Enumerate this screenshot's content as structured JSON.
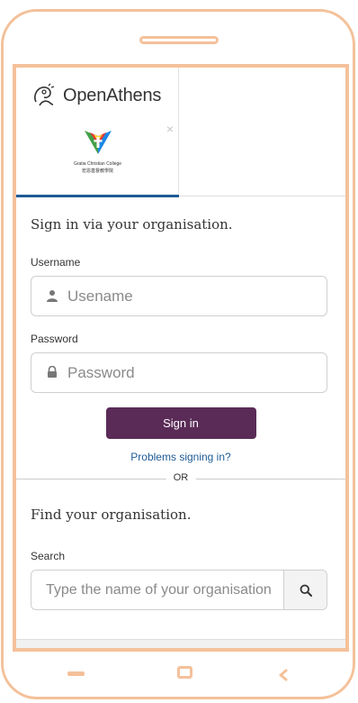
{
  "brand": {
    "name": "OpenAthens"
  },
  "org_tab": {
    "caption": "Gratia Christian College",
    "caption_cn": "宏恩基督教學院",
    "close_glyph": "×"
  },
  "signin": {
    "title": "Sign in via your organisation.",
    "username_label": "Username",
    "username_placeholder": "Usename",
    "password_label": "Password",
    "password_placeholder": "Password",
    "submit_label": "Sign in",
    "problems_link": "Problems signing in?"
  },
  "divider": {
    "text": "OR"
  },
  "find": {
    "title": "Find your organisation.",
    "search_label": "Search",
    "search_placeholder": "Type the name of your organisation"
  },
  "colors": {
    "frame": "#f4c19a",
    "accent": "#5a2b57",
    "link": "#1e5a96"
  }
}
